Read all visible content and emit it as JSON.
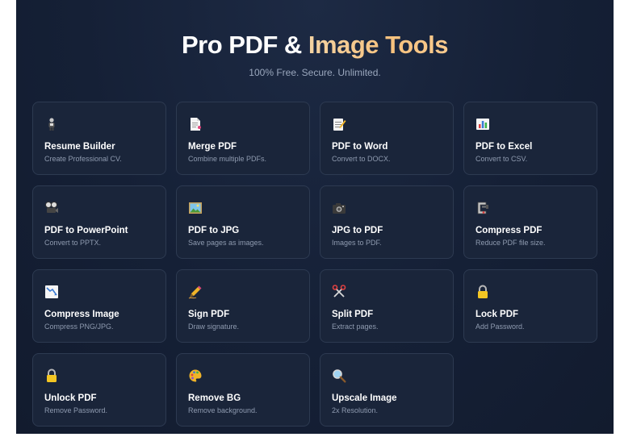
{
  "header": {
    "title_main": "Pro PDF & ",
    "title_accent": "Image Tools",
    "subtitle": "100% Free. Secure. Unlimited."
  },
  "tools": [
    {
      "title": "Resume Builder",
      "desc": "Create Professional CV.",
      "icon": "person-icon"
    },
    {
      "title": "Merge PDF",
      "desc": "Combine multiple PDFs.",
      "icon": "document-icon"
    },
    {
      "title": "PDF to Word",
      "desc": "Convert to DOCX.",
      "icon": "memo-icon"
    },
    {
      "title": "PDF to Excel",
      "desc": "Convert to CSV.",
      "icon": "bar-chart-icon"
    },
    {
      "title": "PDF to PowerPoint",
      "desc": "Convert to PPTX.",
      "icon": "film-projector-icon"
    },
    {
      "title": "PDF to JPG",
      "desc": "Save pages as images.",
      "icon": "picture-icon"
    },
    {
      "title": "JPG to PDF",
      "desc": "Images to PDF.",
      "icon": "camera-icon"
    },
    {
      "title": "Compress PDF",
      "desc": "Reduce PDF file size.",
      "icon": "clamp-icon"
    },
    {
      "title": "Compress Image",
      "desc": "Compress PNG/JPG.",
      "icon": "chart-decreasing-icon"
    },
    {
      "title": "Sign PDF",
      "desc": "Draw signature.",
      "icon": "pen-icon"
    },
    {
      "title": "Split PDF",
      "desc": "Extract pages.",
      "icon": "scissors-icon"
    },
    {
      "title": "Lock PDF",
      "desc": "Add Password.",
      "icon": "lock-icon"
    },
    {
      "title": "Unlock PDF",
      "desc": "Remove Password.",
      "icon": "unlock-icon"
    },
    {
      "title": "Remove BG",
      "desc": "Remove background.",
      "icon": "palette-icon"
    },
    {
      "title": "Upscale Image",
      "desc": "2x Resolution.",
      "icon": "magnifier-icon"
    }
  ],
  "colors": {
    "background": "#152036",
    "card": "#1a253a",
    "card_border": "#2d3a51",
    "accent_gold": "#f7c27e",
    "text_muted": "#8f9bb0"
  }
}
